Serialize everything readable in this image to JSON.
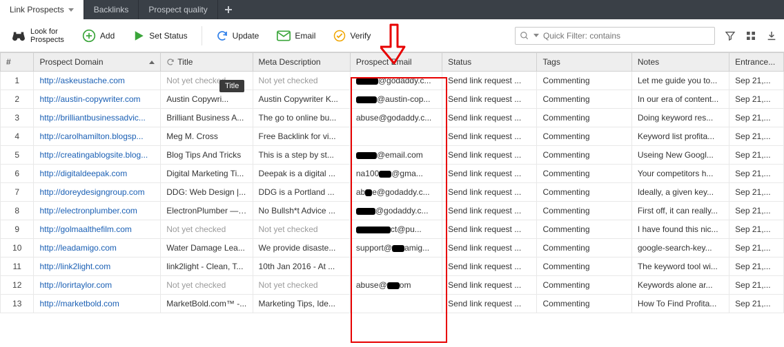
{
  "tabs": {
    "items": [
      {
        "label": "Link Prospects",
        "active": true
      },
      {
        "label": "Backlinks",
        "active": false
      },
      {
        "label": "Prospect quality",
        "active": false
      }
    ]
  },
  "toolbar": {
    "look_for": {
      "line1": "Look for",
      "line2": "Prospects"
    },
    "add": "Add",
    "set_status": "Set Status",
    "update": "Update",
    "email": "Email",
    "verify": "Verify",
    "filter_placeholder": "Quick Filter: contains"
  },
  "tooltip": "Title",
  "columns": {
    "num": "#",
    "domain": "Prospect Domain",
    "title": "Title",
    "meta": "Meta Description",
    "email": "Prospect Email",
    "status": "Status",
    "tags": "Tags",
    "notes": "Notes",
    "entrance": "Entrance..."
  },
  "rows": [
    {
      "n": "1",
      "domain": "http://askeustache.com",
      "title": "Not yet checked",
      "title_muted": true,
      "meta": "Not yet checked",
      "meta_muted": true,
      "email_prefix_redact": 32,
      "email_suffix": "@godaddy.c...",
      "status": "Send link request ...",
      "tags": "Commenting",
      "notes": "Let me guide you to...",
      "entr": "Sep 21,..."
    },
    {
      "n": "2",
      "domain": "http://austin-copywriter.com",
      "title": "Austin Copywri...",
      "meta": "Austin Copywriter K...",
      "email_prefix_redact": 30,
      "email_suffix": "@austin-cop...",
      "status": "Send link request ...",
      "tags": "Commenting",
      "notes": "In our era of content...",
      "entr": "Sep 21,..."
    },
    {
      "n": "3",
      "domain": "http://brilliantbusinessadvic...",
      "title": "Brilliant Business A...",
      "meta": "The go to online bu...",
      "email_prefix_redact": 0,
      "email_suffix": "abuse@godaddy.c...",
      "status": "Send link request ...",
      "tags": "Commenting",
      "notes": "Doing keyword res...",
      "entr": "Sep 21,..."
    },
    {
      "n": "4",
      "domain": "http://carolhamilton.blogsp...",
      "title": "Meg M. Cross",
      "meta": "Free Backlink for vi...",
      "email_prefix_redact": 0,
      "email_suffix": "",
      "status": "Send link request ...",
      "tags": "Commenting",
      "notes": "Keyword list profita...",
      "entr": "Sep 21,..."
    },
    {
      "n": "5",
      "domain": "http://creatingablogsite.blog...",
      "title": "Blog Tips And Tricks",
      "meta": "This is a step by st...",
      "email_prefix_redact": 30,
      "email_suffix": "@email.com",
      "status": "Send link request ...",
      "tags": "Commenting",
      "notes": "Useing New Googl...",
      "entr": "Sep 21,..."
    },
    {
      "n": "6",
      "domain": "http://digitaldeepak.com",
      "title": "Digital Marketing Ti...",
      "meta": "Deepak is a digital ...",
      "email_prefix_redact": 0,
      "email_mid": "na100",
      "email_mid_redact": 18,
      "email_suffix": "@gma...",
      "status": "Send link request ...",
      "tags": "Commenting",
      "notes": "Your competitors h...",
      "entr": "Sep 21,..."
    },
    {
      "n": "7",
      "domain": "http://doreydesigngroup.com",
      "title": "DDG: Web Design |...",
      "meta": "DDG is a Portland ...",
      "email_prefix_redact": 0,
      "email_mid": "ab",
      "email_mid_redact": 10,
      "email_suffix": "e@godaddy.c...",
      "status": "Send link request ...",
      "tags": "Commenting",
      "notes": "Ideally, a given key...",
      "entr": "Sep 21,..."
    },
    {
      "n": "8",
      "domain": "http://electronplumber.com",
      "title": "ElectronPlumber — ...",
      "meta": "No Bullsh*t Advice ...",
      "email_prefix_redact": 28,
      "email_suffix": "@godaddy.c...",
      "status": "Send link request ...",
      "tags": "Commenting",
      "notes": "First off, it can really...",
      "entr": "Sep 21,..."
    },
    {
      "n": "9",
      "domain": "http://golmaalthefilm.com",
      "title": "Not yet checked",
      "title_muted": true,
      "meta": "Not yet checked",
      "meta_muted": true,
      "email_prefix_redact": 50,
      "email_suffix": "ct@pu...",
      "status": "Send link request ...",
      "tags": "Commenting",
      "notes": "I have found this nic...",
      "entr": "Sep 21,..."
    },
    {
      "n": "10",
      "domain": "http://leadamigo.com",
      "title": "Water Damage Lea...",
      "meta": "We provide disaste...",
      "email_prefix_redact": 0,
      "email_mid": "support@",
      "email_mid_redact": 18,
      "email_suffix": "amig...",
      "status": "Send link request ...",
      "tags": "Commenting",
      "notes": "google-search-key...",
      "entr": "Sep 21,..."
    },
    {
      "n": "11",
      "domain": "http://link2light.com",
      "title": "link2light - Clean, T...",
      "meta": "10th Jan 2016 - At ...",
      "email_prefix_redact": 0,
      "email_suffix": "",
      "status": "Send link request ...",
      "tags": "Commenting",
      "notes": "The keyword tool wi...",
      "entr": "Sep 21,..."
    },
    {
      "n": "12",
      "domain": "http://lorirtaylor.com",
      "title": "Not yet checked",
      "title_muted": true,
      "meta": "Not yet checked",
      "meta_muted": true,
      "email_prefix_redact": 0,
      "email_mid": "abuse@",
      "email_mid_redact": 18,
      "email_suffix": "om",
      "status": "Send link request ...",
      "tags": "Commenting",
      "notes": "Keywords alone ar...",
      "entr": "Sep 21,..."
    },
    {
      "n": "13",
      "domain": "http://marketbold.com",
      "title": "MarketBold.com™ -...",
      "meta": "Marketing Tips, Ide...",
      "email_prefix_redact": 0,
      "email_suffix": "",
      "status": "Send link request ...",
      "tags": "Commenting",
      "notes": "How To Find Profita...",
      "entr": "Sep 21,..."
    }
  ]
}
